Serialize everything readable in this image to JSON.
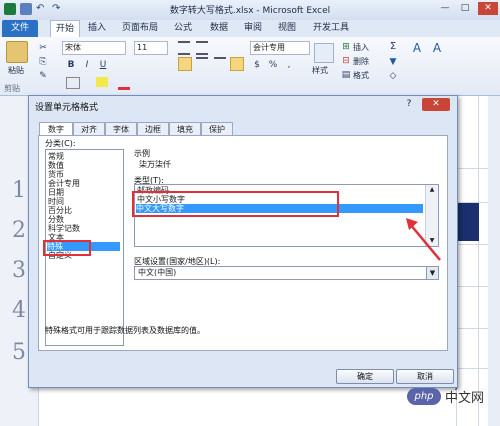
{
  "window": {
    "title": "数字转大写格式.xlsx - Microsoft Excel",
    "minimize": "—",
    "maximize": "□",
    "close": "✕"
  },
  "ribbon": {
    "tabs": [
      "文件",
      "开始",
      "插入",
      "页面布局",
      "公式",
      "数据",
      "审阅",
      "视图",
      "开发工具"
    ],
    "paste_label": "粘贴",
    "clipboard_label": "剪贴",
    "font_name": "宋体",
    "font_size": "11",
    "bold": "B",
    "italic": "I",
    "underline": "U",
    "number_format": "会计专用",
    "currency": "$",
    "percent": "%",
    "comma": ",",
    "style_label": "样式",
    "insert_label": "插入",
    "delete_label": "删除",
    "format_label": "格式",
    "sigma": "Σ",
    "sort_icon_label": "A",
    "find_icon_label": "A"
  },
  "sheet": {
    "row_numbers": [
      "1",
      "2",
      "3",
      "4",
      "5"
    ],
    "right_parens": [
      ")",
      ")",
      ")",
      ")"
    ]
  },
  "dialog": {
    "title": "设置单元格格式",
    "help": "?",
    "close": "✕",
    "tabs": [
      "数字",
      "对齐",
      "字体",
      "边框",
      "填充",
      "保护"
    ],
    "category_label": "分类(C):",
    "categories": [
      "常规",
      "数值",
      "货币",
      "会计专用",
      "日期",
      "时间",
      "百分比",
      "分数",
      "科学记数",
      "文本",
      "特殊",
      "自定义"
    ],
    "selected_category": "特殊",
    "sample_label": "示例",
    "sample_value": "柒万柒仟",
    "type_label": "类型(T):",
    "types": [
      "邮政编码",
      "中文小写数字",
      "中文大写数字"
    ],
    "selected_type": "中文大写数字",
    "locale_label": "区域设置(国家/地区)(L):",
    "locale_value": "中文(中国)",
    "description": "特殊格式可用于跟踪数据列表及数据库的值。",
    "ok_label": "确定",
    "cancel_label": "取消"
  },
  "watermark": {
    "logo": "php",
    "text": "中文网"
  },
  "colors": {
    "file_tab": "#2a70c4",
    "selection": "#3399ff",
    "annotation": "#e0303a",
    "dialog_close": "#c84538"
  }
}
